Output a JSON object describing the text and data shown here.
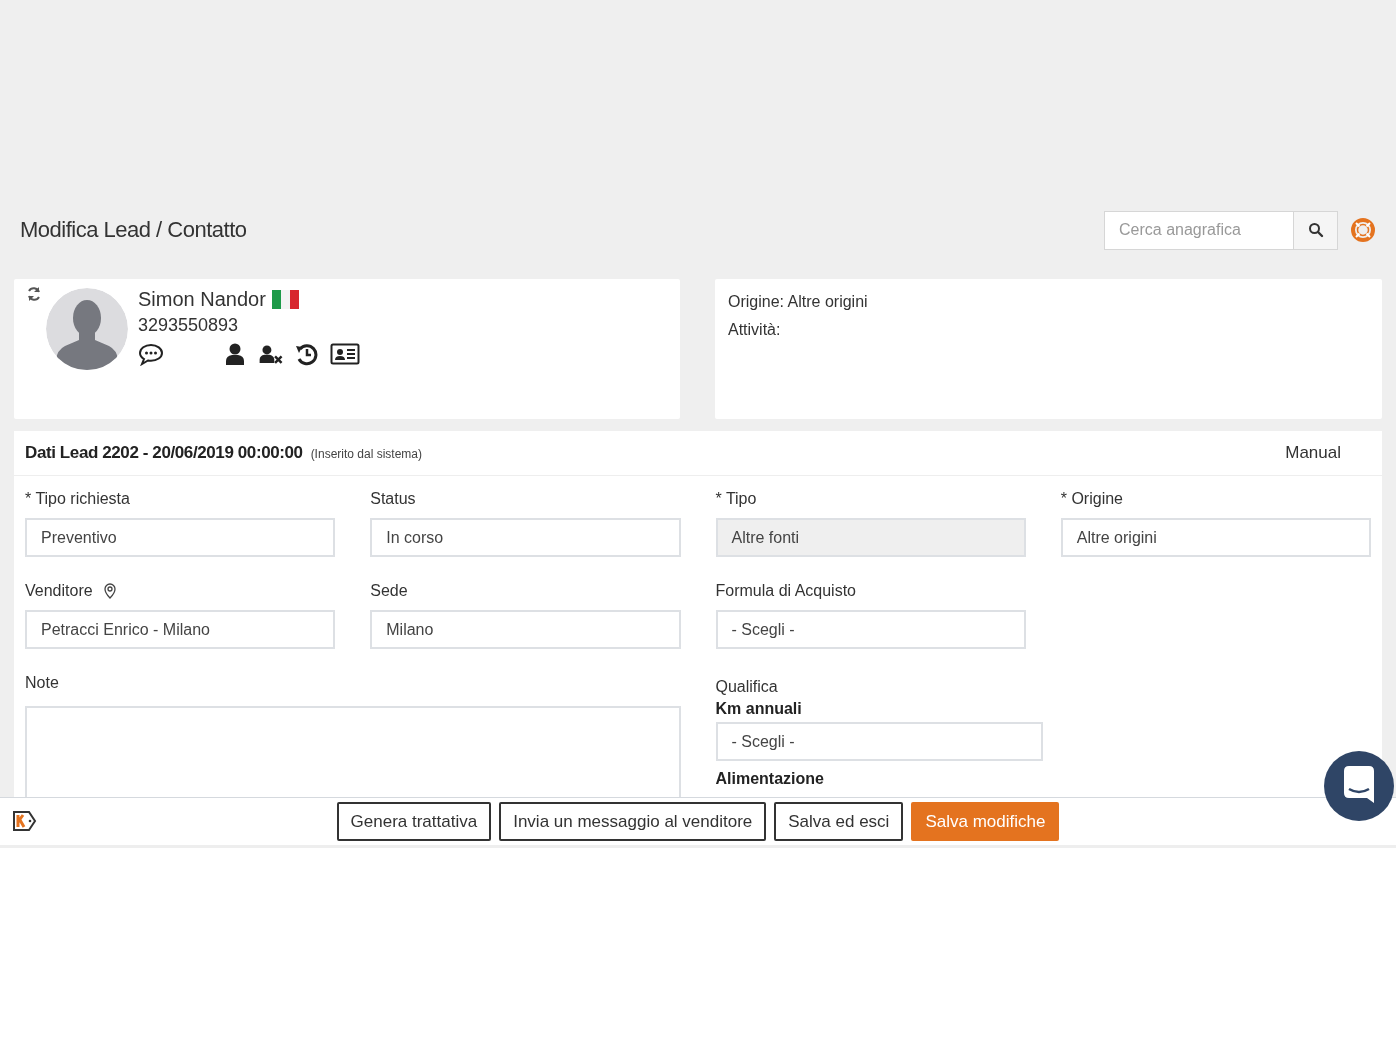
{
  "page": {
    "title": "Modifica Lead / Contatto",
    "search": {
      "placeholder": "Cerca anagrafica"
    }
  },
  "contact": {
    "name": "Simon Nandor",
    "phone": "3293550893"
  },
  "info": {
    "lines": [
      "Origine: Altre origini",
      "Attività:"
    ]
  },
  "lead": {
    "title": "Dati Lead 2202 - 20/06/2019 00:00:00",
    "note": "(Inserito dal sistema)",
    "mode": "Manual",
    "left": [
      {
        "kind": "select",
        "label": "* Tipo richiesta",
        "value": "Preventivo"
      },
      {
        "kind": "select",
        "label": "Status",
        "value": "In corso"
      },
      {
        "kind": "select",
        "label": "Venditore",
        "value": "Petracci Enrico - Milano",
        "location": true
      },
      {
        "kind": "select",
        "label": "Sede",
        "value": "Milano"
      },
      {
        "kind": "textarea",
        "label": "Note"
      }
    ],
    "right": [
      {
        "kind": "select",
        "label": "* Tipo",
        "value": "Altre fonti",
        "disabled": true
      },
      {
        "kind": "select",
        "label": "* Origine",
        "value": "Altre origini"
      },
      {
        "kind": "select",
        "label": "Formula di Acquisto",
        "value": "- Scegli -"
      },
      {
        "kind": "heading",
        "label": "Qualifica"
      },
      {
        "kind": "select",
        "label": "Km annuali",
        "value": "- Scegli -",
        "strong": true
      },
      {
        "kind": "heading",
        "label": "Alimentazione",
        "strong": true
      }
    ]
  },
  "footer": {
    "buttons": [
      {
        "label": "Genera trattativa",
        "primary": false
      },
      {
        "label": "Invia un messaggio al venditore",
        "primary": false
      },
      {
        "label": "Salva ed esci",
        "primary": false
      },
      {
        "label": "Salva modifiche",
        "primary": true
      }
    ]
  }
}
